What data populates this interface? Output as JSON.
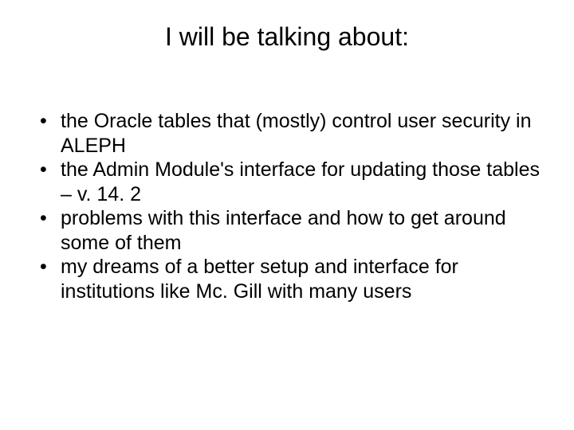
{
  "slide": {
    "title": "I will be talking about:",
    "bullets": [
      "the Oracle tables that (mostly) control user security in ALEPH",
      "the Admin Module's interface for updating those tables – v. 14. 2",
      "problems with this interface and how to get around some of them",
      "my dreams of a better setup and interface for institutions like Mc. Gill with many users"
    ]
  }
}
